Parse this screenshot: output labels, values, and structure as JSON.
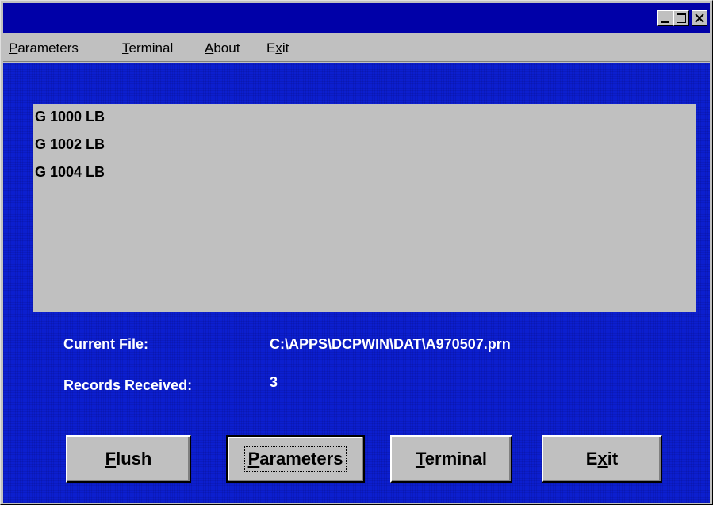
{
  "window": {
    "title": "",
    "controls": [
      "minimize-icon",
      "maximize-icon",
      "close-icon"
    ]
  },
  "menu": {
    "items": [
      {
        "pre": "",
        "key": "P",
        "post": "arameters"
      },
      {
        "pre": "",
        "key": "T",
        "post": "erminal"
      },
      {
        "pre": "",
        "key": "A",
        "post": "bout"
      },
      {
        "pre": "E",
        "key": "x",
        "post": "it"
      }
    ]
  },
  "records_list": [
    "G 1000 LB",
    "G 1002 LB",
    "G 1004 LB"
  ],
  "info": {
    "current_file_label": "Current File:",
    "current_file_value": "C:\\APPS\\DCPWIN\\DAT\\A970507.prn",
    "records_received_label": "Records Received:",
    "records_received_value": "3"
  },
  "buttons": {
    "flush": {
      "pre": "",
      "key": "F",
      "post": "lush"
    },
    "parameters": {
      "pre": "",
      "key": "P",
      "post": "arameters"
    },
    "terminal": {
      "pre": "",
      "key": "T",
      "post": "erminal"
    },
    "exit": {
      "pre": "E",
      "key": "x",
      "post": "it"
    }
  },
  "colors": {
    "title_bar": "#0000a8",
    "client_background": "#0c1fcf",
    "chrome": "#c0c0c0",
    "info_text": "#ffffff"
  }
}
